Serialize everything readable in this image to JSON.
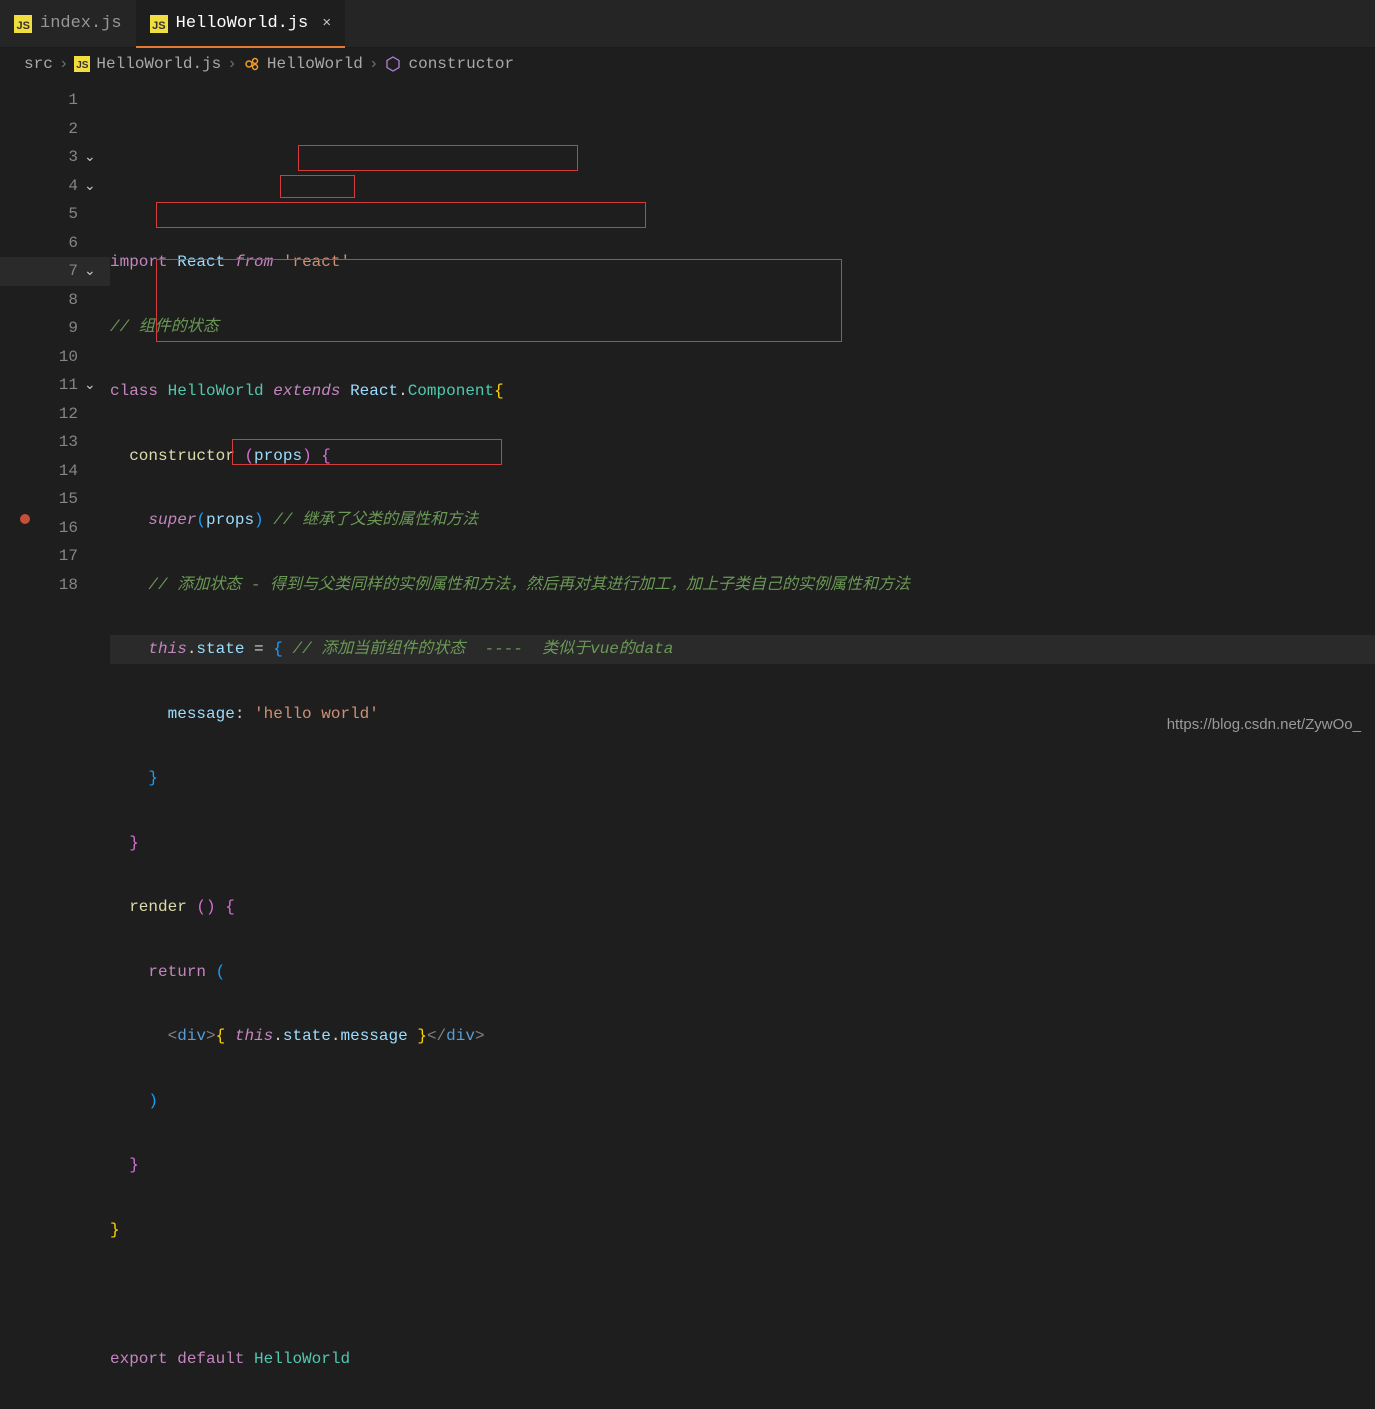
{
  "tabs": [
    {
      "label": "index.js",
      "active": false
    },
    {
      "label": "HelloWorld.js",
      "active": true
    }
  ],
  "breadcrumbs": {
    "root": "src",
    "file": "HelloWorld.js",
    "cls": "HelloWorld",
    "method": "constructor"
  },
  "code": {
    "l1": {
      "a": "import",
      "b": "React",
      "c": "from",
      "d": "'react'"
    },
    "l2": {
      "a": "// 组件的状态"
    },
    "l3": {
      "a": "class",
      "b": "HelloWorld",
      "c": "extends",
      "d": "React",
      "e": "Component",
      "f": "{"
    },
    "l4": {
      "a": "constructor",
      "b": "(",
      "c": "props",
      "d": ")",
      "e": "{"
    },
    "l5": {
      "a": "super",
      "b": "(",
      "c": "props",
      "d": ")",
      "e": "// 继承了父类的属性和方法"
    },
    "l6": {
      "a": "// 添加状态 - 得到与父类同样的实例属性和方法，然后再对其进行加工，加上子类自己的实例属性和方法"
    },
    "l7": {
      "a": "this",
      "b": ".",
      "c": "state",
      "d": " = ",
      "e": "{",
      "f": "// 添加当前组件的状态  ----  类似于vue的data"
    },
    "l8": {
      "a": "message",
      "b": ":",
      "c": "'hello world'"
    },
    "l9": {
      "a": "}"
    },
    "l10": {
      "a": "}"
    },
    "l11": {
      "a": "render",
      "b": "(",
      "c": ")",
      "d": "{"
    },
    "l12": {
      "a": "return",
      "b": "("
    },
    "l13": {
      "a": "<",
      "b": "div",
      "c": ">",
      "d": "{",
      "e": "this",
      "f": ".",
      "g": "state",
      "h": ".",
      "i": "message",
      "j": "}",
      "k": "</",
      "l": "div",
      "m": ">"
    },
    "l14": {
      "a": ")"
    },
    "l15": {
      "a": "}"
    },
    "l16": {
      "a": "}"
    },
    "l18": {
      "a": "export",
      "b": "default",
      "c": "HelloWorld"
    }
  },
  "lineNumbers": [
    "1",
    "2",
    "3",
    "4",
    "5",
    "6",
    "7",
    "8",
    "9",
    "10",
    "11",
    "12",
    "13",
    "14",
    "15",
    "16",
    "17",
    "18"
  ],
  "watermark": "https://blog.csdn.net/ZywOo_"
}
